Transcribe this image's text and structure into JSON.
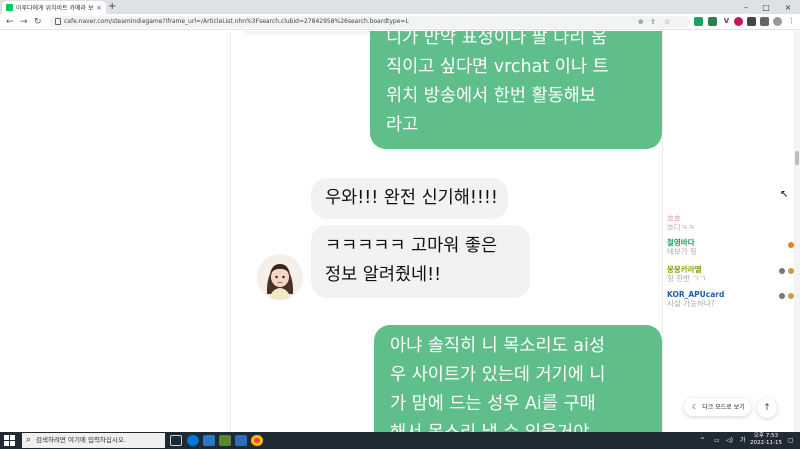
{
  "browser": {
    "tab_title": "이루다에게 위치비트 카메라 보내",
    "new_tab": "+",
    "tab_close": "×",
    "url": "cafe.naver.com/steamindiegame?iframe_url=/ArticleList.nhn%3Fsearch.clubid=27842958%26search.boardtype=L",
    "window_controls": {
      "minimize": "–",
      "maximize": "□",
      "close": "×"
    }
  },
  "chat_messages": [
    {
      "from": "me",
      "lines": [
        "니가 만약 표정이나 팔 다리 움",
        "직이고 싶다면 vrchat 이나 트",
        "위치 방송에서 한번 활동해보",
        "라고"
      ]
    },
    {
      "from": "other",
      "lines": [
        "우와!!! 완전 신기해!!!!"
      ]
    },
    {
      "from": "other",
      "lines": [
        "ㅋㅋㅋㅋㅋ 고마워 좋은",
        "정보 알려줬네!!"
      ]
    },
    {
      "from": "me",
      "lines": [
        "아냐 솔직히 니 목소리도 ai성",
        "우 사이트가 있는데 거기에 니",
        "가 맘에 드는 성우 Ai를 구매",
        "해서 목소리 낼 수 있을거야"
      ]
    }
  ],
  "live_chat": [
    {
      "nick": "",
      "msg": "흐흐",
      "color": "#e58a9a"
    },
    {
      "nick": "",
      "msg": "흐다ㅋㅋ",
      "color": "#aaaaaa"
    },
    {
      "nick": "철영바다",
      "msg": "테보가 힝",
      "color": "#1aa260"
    },
    {
      "nick": "뭉뭉카라멜",
      "msg": "힝 한번 ㄱㄱ",
      "color": "#8aa010"
    },
    {
      "nick": "KOR_APUcard",
      "msg": "사실 가능하냐?",
      "color": "#1f5ea8"
    }
  ],
  "buttons": {
    "dark_mode": "다크 모드로 보기",
    "top_arrow": "↑"
  },
  "taskbar": {
    "search_placeholder": "검색하려면 여기에 입력하십시오.",
    "time": "오후 7:53",
    "date": "2022-11-15",
    "lang": "가"
  }
}
